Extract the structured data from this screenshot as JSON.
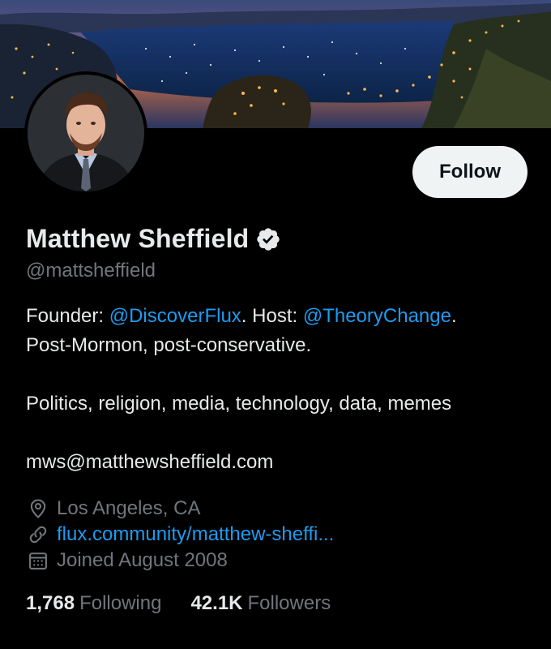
{
  "profile": {
    "display_name": "Matthew Sheffield",
    "handle": "@mattsheffield",
    "verified": true,
    "follow_label": "Follow",
    "bio": {
      "line1_prefix": "Founder: ",
      "mention1": "@DiscoverFlux",
      "line1_middle": ". Host: ",
      "mention2": "@TheoryChange",
      "line1_suffix": ".",
      "line2": "Post-Mormon, post-conservative.",
      "line3": "Politics, religion, media, technology, data, memes",
      "line4": "mws@matthewsheffield.com"
    },
    "location": "Los Angeles, CA",
    "website": "flux.community/matthew-sheffi...",
    "joined": "Joined August 2008",
    "following_count": "1,768",
    "following_label": "Following",
    "followers_count": "42.1K",
    "followers_label": "Followers"
  },
  "icons": {
    "location": "location-pin-icon",
    "link": "link-icon",
    "calendar": "calendar-icon",
    "verified": "verified-badge-icon"
  },
  "colors": {
    "link": "#1d9bf0",
    "muted": "#71767b",
    "text": "#e7e9ea"
  }
}
